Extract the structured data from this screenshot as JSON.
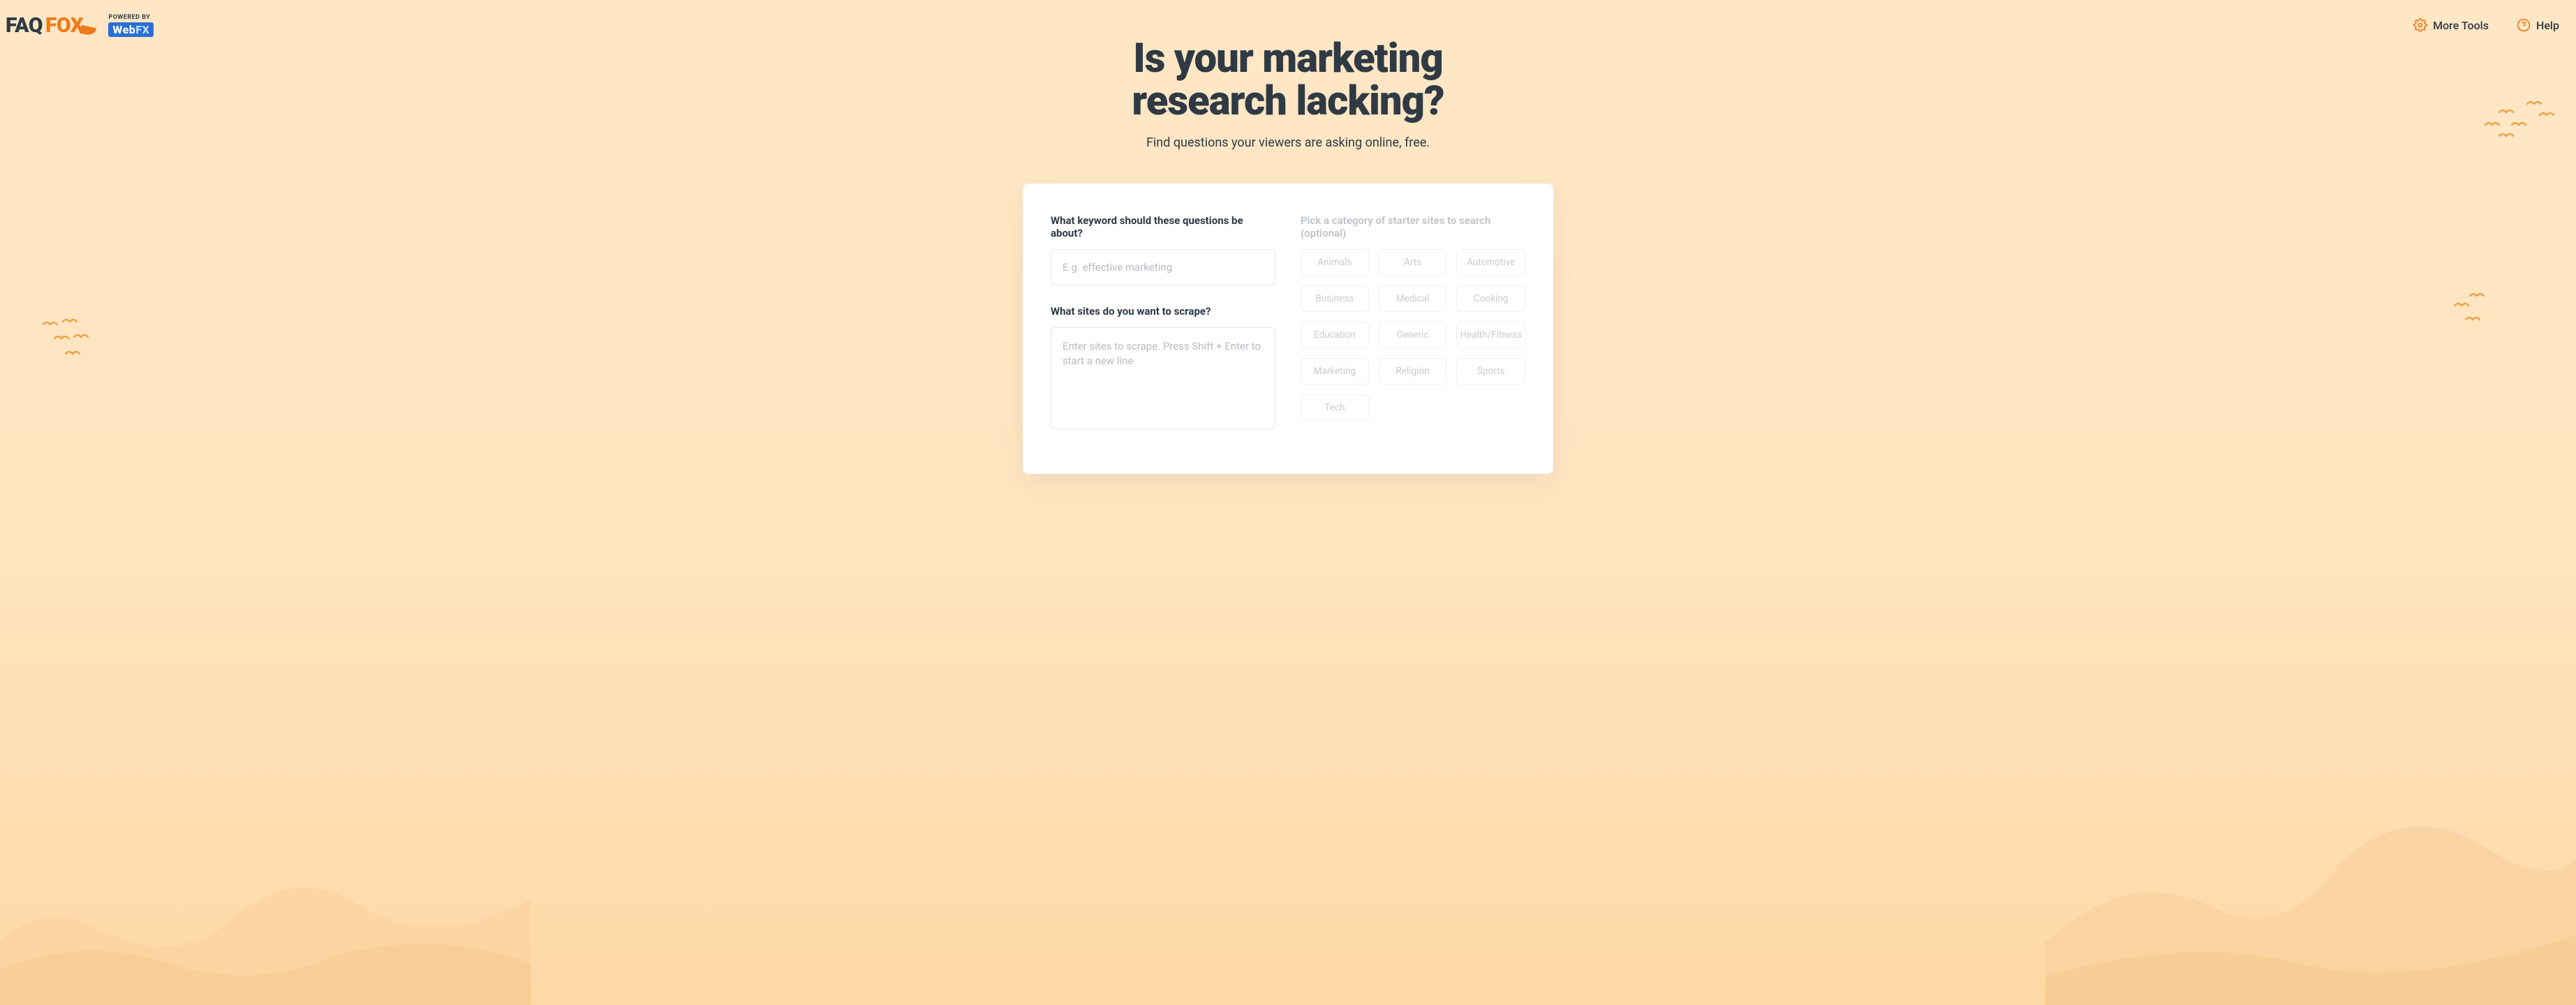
{
  "header": {
    "logo_part1": "FAQ",
    "logo_part2": "FOX",
    "powered_by_label": "POWERED BY",
    "powered_by_brand_a": "Web",
    "powered_by_brand_b": "FX",
    "more_tools": "More Tools",
    "help": "Help"
  },
  "hero": {
    "title_line1": "Is your marketing",
    "title_line2": "research lacking?",
    "subtitle": "Find questions your viewers are asking online, free."
  },
  "form": {
    "keyword_label": "What keyword should these questions be about?",
    "keyword_placeholder": "E.g. effective marketing",
    "sites_label": "What sites do you want to scrape?",
    "sites_placeholder": "Enter sites to scrape. Press Shift + Enter to start a new line",
    "category_label": "Pick a category of starter sites to search (optional)",
    "categories": [
      "Animals",
      "Arts",
      "Automotive",
      "Business",
      "Medical",
      "Cooking",
      "Education",
      "Generic",
      "Health/Fitness",
      "Marketing",
      "Religion",
      "Sports",
      "Tech"
    ]
  }
}
